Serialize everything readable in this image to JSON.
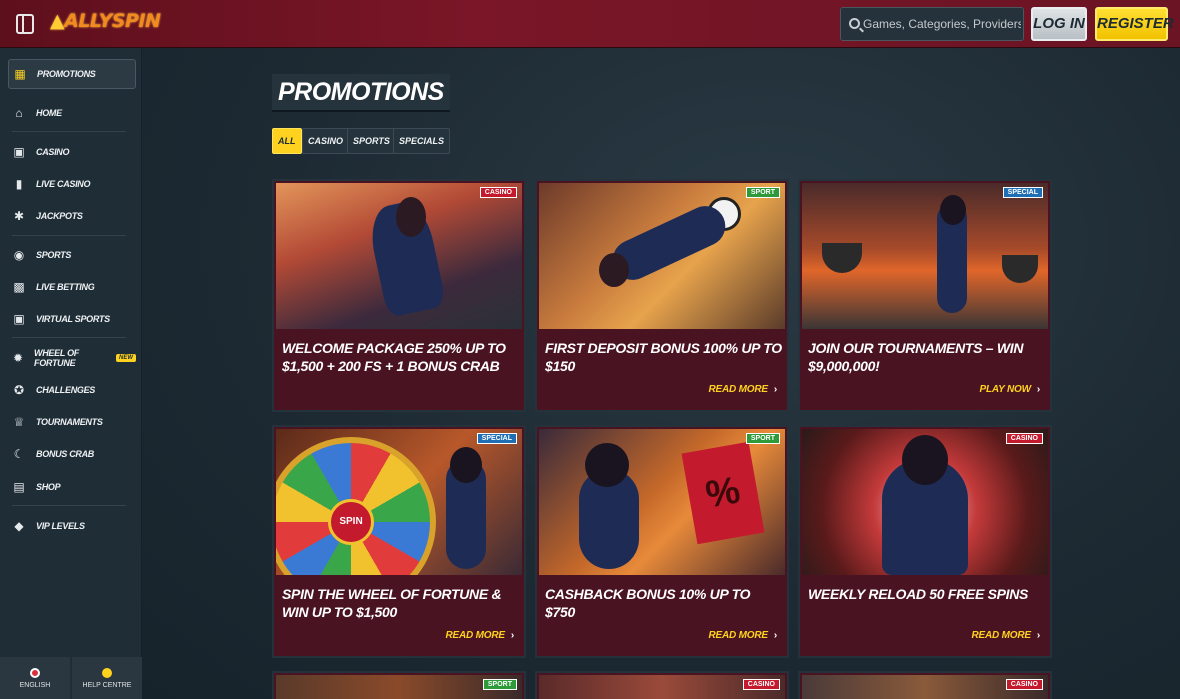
{
  "header": {
    "logo": "ALLYSPIN",
    "search_placeholder": "Games, Categories, Providers",
    "login_label": "LOG IN",
    "register_label": "REGISTER"
  },
  "sidebar": {
    "items": [
      {
        "label": "PROMOTIONS",
        "icon": "gift-icon"
      },
      {
        "label": "HOME",
        "icon": "home-icon"
      },
      {
        "label": "CASINO",
        "icon": "slot-machine-icon"
      },
      {
        "label": "LIVE CASINO",
        "icon": "card-icon"
      },
      {
        "label": "JACKPOTS",
        "icon": "jackpot-icon"
      },
      {
        "label": "SPORTS",
        "icon": "football-icon"
      },
      {
        "label": "LIVE BETTING",
        "icon": "live-icon"
      },
      {
        "label": "VIRTUAL SPORTS",
        "icon": "virtual-icon"
      },
      {
        "label": "WHEEL OF FORTUNE",
        "icon": "wheel-icon",
        "badge": "NEW"
      },
      {
        "label": "CHALLENGES",
        "icon": "medal-icon"
      },
      {
        "label": "TOURNAMENTS",
        "icon": "trophy-icon"
      },
      {
        "label": "BONUS CRAB",
        "icon": "crab-icon"
      },
      {
        "label": "SHOP",
        "icon": "cart-icon"
      },
      {
        "label": "VIP LEVELS",
        "icon": "diamond-icon"
      }
    ],
    "footer": {
      "language": "ENGLISH",
      "help": "HELP CENTRE"
    }
  },
  "main": {
    "title": "PROMOTIONS",
    "filters": [
      "ALL",
      "CASINO",
      "SPORTS",
      "SPECIALS"
    ],
    "active_filter": "ALL",
    "cards": [
      {
        "tag": "CASINO",
        "tag_type": "casino",
        "title": "WELCOME PACKAGE 250% UP TO $1,500 + 200 FS + 1 BONUS CRAB",
        "cta": ""
      },
      {
        "tag": "SPORT",
        "tag_type": "sport",
        "title": "FIRST DEPOSIT BONUS 100% UP TO $150",
        "cta": "READ MORE"
      },
      {
        "tag": "SPECIAL",
        "tag_type": "special",
        "title": "JOIN OUR TOURNAMENTS – WIN $9,000,000!",
        "cta": "PLAY NOW"
      },
      {
        "tag": "SPECIAL",
        "tag_type": "special",
        "title": "SPIN THE WHEEL OF FORTUNE & WIN UP TO $1,500",
        "cta": "READ MORE"
      },
      {
        "tag": "SPORT",
        "tag_type": "sport",
        "title": "CASHBACK BONUS 10% UP TO $750",
        "cta": "READ MORE"
      },
      {
        "tag": "CASINO",
        "tag_type": "casino",
        "title": "WEEKLY RELOAD 50 FREE SPINS",
        "cta": "READ MORE"
      },
      {
        "tag": "SPORT",
        "tag_type": "sport",
        "title": "",
        "cta": ""
      },
      {
        "tag": "CASINO",
        "tag_type": "casino",
        "title": "",
        "cta": ""
      },
      {
        "tag": "CASINO",
        "tag_type": "casino",
        "title": "",
        "cta": ""
      }
    ]
  },
  "colors": {
    "accent": "#ffd21f",
    "card_bg": "#4a1322",
    "header": "#6a1424"
  }
}
